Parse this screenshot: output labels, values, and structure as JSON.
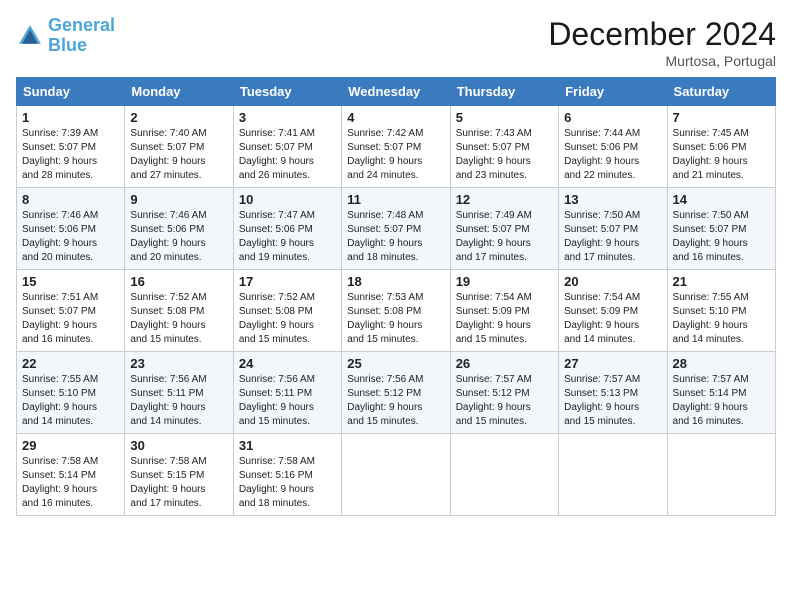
{
  "header": {
    "logo_line1": "General",
    "logo_line2": "Blue",
    "title": "December 2024",
    "subtitle": "Murtosa, Portugal"
  },
  "weekdays": [
    "Sunday",
    "Monday",
    "Tuesday",
    "Wednesday",
    "Thursday",
    "Friday",
    "Saturday"
  ],
  "weeks": [
    [
      {
        "day": "1",
        "info": "Sunrise: 7:39 AM\nSunset: 5:07 PM\nDaylight: 9 hours\nand 28 minutes."
      },
      {
        "day": "2",
        "info": "Sunrise: 7:40 AM\nSunset: 5:07 PM\nDaylight: 9 hours\nand 27 minutes."
      },
      {
        "day": "3",
        "info": "Sunrise: 7:41 AM\nSunset: 5:07 PM\nDaylight: 9 hours\nand 26 minutes."
      },
      {
        "day": "4",
        "info": "Sunrise: 7:42 AM\nSunset: 5:07 PM\nDaylight: 9 hours\nand 24 minutes."
      },
      {
        "day": "5",
        "info": "Sunrise: 7:43 AM\nSunset: 5:07 PM\nDaylight: 9 hours\nand 23 minutes."
      },
      {
        "day": "6",
        "info": "Sunrise: 7:44 AM\nSunset: 5:06 PM\nDaylight: 9 hours\nand 22 minutes."
      },
      {
        "day": "7",
        "info": "Sunrise: 7:45 AM\nSunset: 5:06 PM\nDaylight: 9 hours\nand 21 minutes."
      }
    ],
    [
      {
        "day": "8",
        "info": "Sunrise: 7:46 AM\nSunset: 5:06 PM\nDaylight: 9 hours\nand 20 minutes."
      },
      {
        "day": "9",
        "info": "Sunrise: 7:46 AM\nSunset: 5:06 PM\nDaylight: 9 hours\nand 20 minutes."
      },
      {
        "day": "10",
        "info": "Sunrise: 7:47 AM\nSunset: 5:06 PM\nDaylight: 9 hours\nand 19 minutes."
      },
      {
        "day": "11",
        "info": "Sunrise: 7:48 AM\nSunset: 5:07 PM\nDaylight: 9 hours\nand 18 minutes."
      },
      {
        "day": "12",
        "info": "Sunrise: 7:49 AM\nSunset: 5:07 PM\nDaylight: 9 hours\nand 17 minutes."
      },
      {
        "day": "13",
        "info": "Sunrise: 7:50 AM\nSunset: 5:07 PM\nDaylight: 9 hours\nand 17 minutes."
      },
      {
        "day": "14",
        "info": "Sunrise: 7:50 AM\nSunset: 5:07 PM\nDaylight: 9 hours\nand 16 minutes."
      }
    ],
    [
      {
        "day": "15",
        "info": "Sunrise: 7:51 AM\nSunset: 5:07 PM\nDaylight: 9 hours\nand 16 minutes."
      },
      {
        "day": "16",
        "info": "Sunrise: 7:52 AM\nSunset: 5:08 PM\nDaylight: 9 hours\nand 15 minutes."
      },
      {
        "day": "17",
        "info": "Sunrise: 7:52 AM\nSunset: 5:08 PM\nDaylight: 9 hours\nand 15 minutes."
      },
      {
        "day": "18",
        "info": "Sunrise: 7:53 AM\nSunset: 5:08 PM\nDaylight: 9 hours\nand 15 minutes."
      },
      {
        "day": "19",
        "info": "Sunrise: 7:54 AM\nSunset: 5:09 PM\nDaylight: 9 hours\nand 15 minutes."
      },
      {
        "day": "20",
        "info": "Sunrise: 7:54 AM\nSunset: 5:09 PM\nDaylight: 9 hours\nand 14 minutes."
      },
      {
        "day": "21",
        "info": "Sunrise: 7:55 AM\nSunset: 5:10 PM\nDaylight: 9 hours\nand 14 minutes."
      }
    ],
    [
      {
        "day": "22",
        "info": "Sunrise: 7:55 AM\nSunset: 5:10 PM\nDaylight: 9 hours\nand 14 minutes."
      },
      {
        "day": "23",
        "info": "Sunrise: 7:56 AM\nSunset: 5:11 PM\nDaylight: 9 hours\nand 14 minutes."
      },
      {
        "day": "24",
        "info": "Sunrise: 7:56 AM\nSunset: 5:11 PM\nDaylight: 9 hours\nand 15 minutes."
      },
      {
        "day": "25",
        "info": "Sunrise: 7:56 AM\nSunset: 5:12 PM\nDaylight: 9 hours\nand 15 minutes."
      },
      {
        "day": "26",
        "info": "Sunrise: 7:57 AM\nSunset: 5:12 PM\nDaylight: 9 hours\nand 15 minutes."
      },
      {
        "day": "27",
        "info": "Sunrise: 7:57 AM\nSunset: 5:13 PM\nDaylight: 9 hours\nand 15 minutes."
      },
      {
        "day": "28",
        "info": "Sunrise: 7:57 AM\nSunset: 5:14 PM\nDaylight: 9 hours\nand 16 minutes."
      }
    ],
    [
      {
        "day": "29",
        "info": "Sunrise: 7:58 AM\nSunset: 5:14 PM\nDaylight: 9 hours\nand 16 minutes."
      },
      {
        "day": "30",
        "info": "Sunrise: 7:58 AM\nSunset: 5:15 PM\nDaylight: 9 hours\nand 17 minutes."
      },
      {
        "day": "31",
        "info": "Sunrise: 7:58 AM\nSunset: 5:16 PM\nDaylight: 9 hours\nand 18 minutes."
      },
      null,
      null,
      null,
      null
    ]
  ]
}
